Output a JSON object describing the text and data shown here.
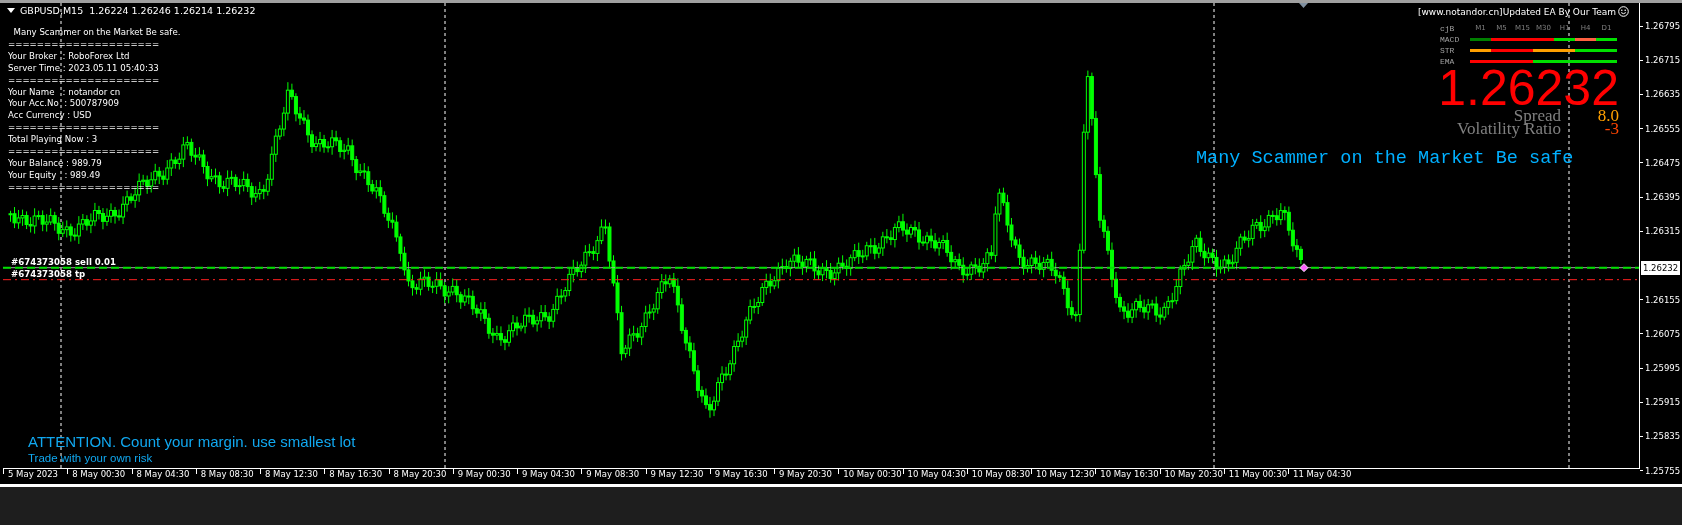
{
  "chart_header": {
    "title": "GBPUSD,M15  1.26224 1.26246 1.26214 1.26232"
  },
  "info_panel": {
    "lines": [
      "  Many Scammer on the Market Be safe.",
      "=====================",
      "Your Broker  : RoboForex Ltd",
      "Server Time : 2023.05.11 05:40:33",
      "=====================",
      "Your Name   : notandor cn",
      "Your Acc.No  : 500787909",
      "Acc Currency : USD",
      "=====================",
      "Total Playing Now : 3",
      "=====================",
      "Your Balance : 989.79",
      "Your Equity   : 989.49",
      "====================="
    ]
  },
  "orders": [
    {
      "kind": "entry",
      "label": "#674373058 sell 0.01"
    },
    {
      "kind": "take_profit",
      "label": "#674373058 tp"
    }
  ],
  "ea_panel": {
    "banner": "[www.notandor.cn]Updated EA By Our Team",
    "header": "cjB",
    "timeframes": [
      "M1",
      "M5",
      "M15",
      "M30",
      "H1",
      "H4",
      "D1"
    ],
    "rows": [
      {
        "label": "MACD",
        "segments": [
          {
            "color": "#008000"
          },
          {
            "color": "#ff0000"
          },
          {
            "color": "#ff0000"
          },
          {
            "color": "#ff0000"
          },
          {
            "color": "#00e000"
          },
          {
            "color": "#ff6040"
          },
          {
            "color": "#00e000"
          }
        ]
      },
      {
        "label": "STR",
        "segments": [
          {
            "color": "#ffa000"
          },
          {
            "color": "#ff0000"
          },
          {
            "color": "#ff0000"
          },
          {
            "color": "#ffa000"
          },
          {
            "color": "#ffa000"
          },
          {
            "color": "#00e000"
          },
          {
            "color": "#00e000"
          }
        ]
      },
      {
        "label": "EMA",
        "segments": [
          {
            "color": "#ff0000"
          },
          {
            "color": "#ff0000"
          },
          {
            "color": "#ff0000"
          },
          {
            "color": "#00e000"
          },
          {
            "color": "#00e000"
          },
          {
            "color": "#00e000"
          },
          {
            "color": "#00e000"
          }
        ]
      }
    ],
    "price": "1.26232",
    "spread_label": "Spread",
    "spread_value": "8.0",
    "volatility_label": "Volatility Ratio",
    "volatility_value": "-3"
  },
  "warning_banner": "Many Scammer on the Market Be safe",
  "footer_notes": [
    "ATTENTION. Count your margin. use smallest lot",
    "Trade with your own risk"
  ],
  "price_axis": {
    "labels": [
      "1.26795",
      "1.26715",
      "1.26635",
      "1.26555",
      "1.26475",
      "1.26395",
      "1.26315",
      "1.26155",
      "1.26075",
      "1.25995",
      "1.25915",
      "1.25835",
      "1.25755"
    ],
    "current_price": "1.26232"
  },
  "time_axis": {
    "labels": [
      "5 May 2023",
      "8 May 00:30",
      "8 May 04:30",
      "8 May 08:30",
      "8 May 12:30",
      "8 May 16:30",
      "8 May 20:30",
      "9 May 00:30",
      "9 May 04:30",
      "9 May 08:30",
      "9 May 12:30",
      "9 May 16:30",
      "9 May 20:30",
      "10 May 00:30",
      "10 May 04:30",
      "10 May 08:30",
      "10 May 12:30",
      "10 May 16:30",
      "10 May 20:30",
      "11 May 00:30",
      "11 May 04:30"
    ]
  }
}
